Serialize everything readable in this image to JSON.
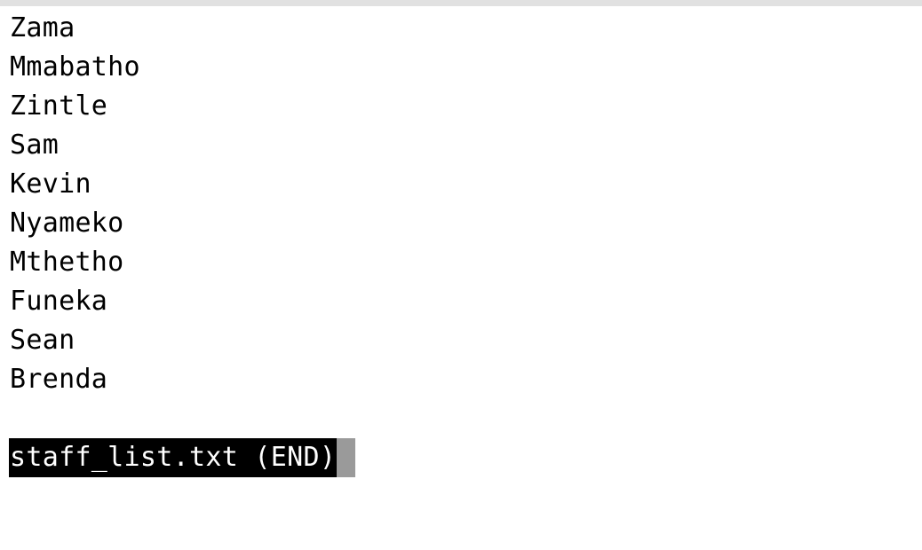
{
  "terminal": {
    "lines": [
      "Zama",
      "Mmabatho",
      "Zintle",
      "Sam",
      "Kevin",
      "Nyameko",
      "Mthetho",
      "Funeka",
      "Sean",
      "Brenda"
    ],
    "status": "staff_list.txt (END)"
  },
  "colors": {
    "background": "#ffffff",
    "text": "#000000",
    "status_background": "#000000",
    "status_text": "#ffffff",
    "cursor": "#9a9a9a",
    "top_bar": "#e1e1e1"
  }
}
